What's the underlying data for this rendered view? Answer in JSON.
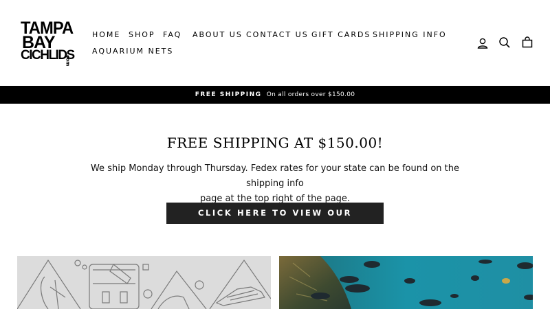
{
  "logo": {
    "line1": "TAMPA",
    "line2": "BAY",
    "line3": "CICHLIDS",
    "suffix": ".com"
  },
  "nav": {
    "items": [
      {
        "label": "HOME"
      },
      {
        "label": "SHOP"
      },
      {
        "label": "FAQ"
      },
      {
        "label": "ABOUT US"
      },
      {
        "label": "CONTACT US"
      },
      {
        "label": "GIFT CARDS"
      },
      {
        "label": "SHIPPING INFO"
      },
      {
        "label": "AQUARIUM NETS"
      }
    ]
  },
  "header_icons": {
    "account": "user-icon",
    "search": "search-icon",
    "cart": "cart-icon"
  },
  "announcement": {
    "bold": "FREE SHIPPING",
    "text": "On all orders over $150.00"
  },
  "hero": {
    "title": "FREE SHIPPING AT $150.00!",
    "line1": "We ship Monday through Thursday. Fedex rates for your state can be found on the shipping info",
    "line2": "page at the top right of the page.",
    "cta_label": "CLICK HERE TO VIEW OUR SELECTION."
  },
  "colors": {
    "bar": "#000000",
    "cta": "#222222",
    "water": "#0a6f86"
  }
}
